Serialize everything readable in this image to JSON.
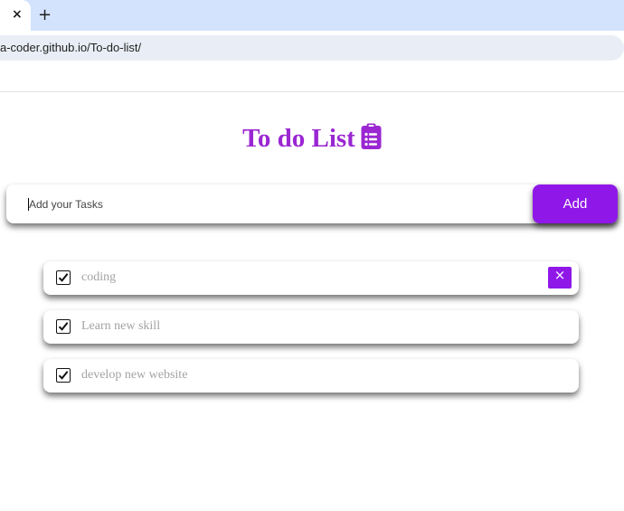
{
  "browser": {
    "tab_close": "×",
    "new_tab": "+",
    "url": "a-coder.github.io/To-do-list/"
  },
  "app": {
    "title": "To do List",
    "title_icon": "clipboard-list-icon",
    "accent_color": "#9a27d2",
    "button_color": "#8f18e8"
  },
  "input": {
    "placeholder": "Add your Tasks",
    "value": "",
    "add_label": "Add"
  },
  "tasks": [
    {
      "text": "coding",
      "checked": true,
      "show_delete": true,
      "delete_label": "×"
    },
    {
      "text": "Learn new skill",
      "checked": true,
      "show_delete": false
    },
    {
      "text": "develop new website",
      "checked": true,
      "show_delete": false
    }
  ]
}
